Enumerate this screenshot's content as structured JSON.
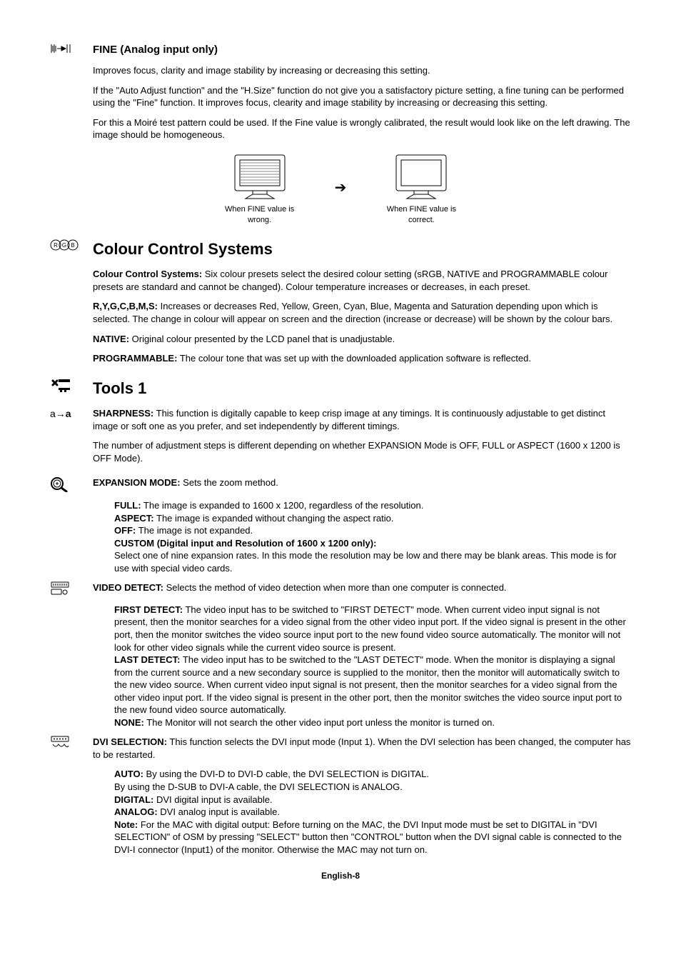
{
  "fine": {
    "icon": "fine-icon",
    "title": "FINE (Analog input only)",
    "p1": "Improves focus, clarity and image stability by increasing or decreasing this setting.",
    "p2": "If the \"Auto Adjust function\" and the \"H.Size\" function do not give you a satisfactory picture setting, a fine tuning can be performed using the \"Fine\" function. It improves focus, clearity and image stability by increasing or decreasing this setting.",
    "p3": "For this a Moiré test pattern could be used. If the Fine value is wrongly calibrated, the result would look like on the left drawing. The image should be homogeneous.",
    "fig_wrong": "When FINE value is wrong.",
    "fig_correct": "When FINE value is correct."
  },
  "colour": {
    "icon": "rgb-icon",
    "title": "Colour Control Systems",
    "ccs_label": "Colour Control Systems:",
    "ccs_body": " Six colour presets select the desired colour setting (sRGB, NATIVE and PROGRAMMABLE colour presets are standard and cannot be changed). Colour temperature increases or decreases, in each preset.",
    "rgb_label": "R,Y,G,C,B,M,S:",
    "rgb_body": " Increases or decreases Red, Yellow, Green, Cyan, Blue, Magenta and Saturation depending upon which is selected. The change in colour will appear on screen and the direction (increase or decrease) will be shown by the colour bars.",
    "native_label": "NATIVE:",
    "native_body": " Original colour presented by the LCD panel that is unadjustable.",
    "prog_label": "PROGRAMMABLE:",
    "prog_body": " The colour tone that was set up with the downloaded application software is reflected."
  },
  "tools": {
    "icon": "tools-icon",
    "title": "Tools 1",
    "sharp_icon": "sharpness-icon",
    "sharp_label": "SHARPNESS:",
    "sharp_body": " This function is digitally capable to keep crisp image at any timings. It is continuously adjustable to get distinct image or soft one as you prefer, and set independently by different timings.",
    "sharp_p2": "The number of adjustment steps is different depending on whether EXPANSION Mode is OFF, FULL or ASPECT (1600 x 1200 is OFF Mode).",
    "exp_icon": "expansion-icon",
    "exp_label": "EXPANSION MODE:",
    "exp_body": " Sets the zoom method.",
    "exp_full_label": "FULL:",
    "exp_full_body": " The image is expanded to 1600 x 1200, regardless of the resolution.",
    "exp_aspect_label": "ASPECT:",
    "exp_aspect_body": " The image is expanded without changing the aspect ratio.",
    "exp_off_label": "OFF:",
    "exp_off_body": " The image is not expanded.",
    "exp_custom_label": "CUSTOM (Digital input and Resolution of 1600 x 1200 only):",
    "exp_custom_body": "Select one of nine expansion rates. In this mode the resolution may be low and there may be blank areas. This mode is for use with special video cards.",
    "vd_icon": "video-detect-icon",
    "vd_label": "VIDEO DETECT:",
    "vd_body": " Selects the method of video detection when more than one computer is connected.",
    "vd_first_label": "FIRST DETECT:",
    "vd_first_body": " The video input has to be switched to \"FIRST DETECT\" mode. When current video input signal is not present, then the monitor searches for a video signal from the other video input port. If the video signal is present in the other port, then the monitor switches the video source input port to the new found video source automatically. The monitor will not look for other video signals while the current video source is present.",
    "vd_last_label": "LAST DETECT:",
    "vd_last_body": " The video input has to be switched to the \"LAST DETECT\" mode. When the monitor is displaying a signal from the current source and a new secondary source is supplied to the monitor, then the monitor will automatically switch to the new video source. When current video input signal is not present, then the monitor searches for a video signal from the other video input port. If the video signal is present in the other port, then the monitor switches the video source input port to the new found video source automatically.",
    "vd_none_label": "NONE:",
    "vd_none_body": " The Monitor will not search the other video input port unless the monitor is turned on.",
    "dvi_icon": "dvi-icon",
    "dvi_label": "DVI SELECTION:",
    "dvi_body": " This function selects the DVI input mode (Input 1). When the DVI selection has been changed, the computer has to be restarted.",
    "dvi_auto_label": "AUTO:",
    "dvi_auto_body": " By using the DVI-D to DVI-D cable, the DVI SELECTION is DIGITAL.",
    "dvi_auto_body2": "By using the D-SUB to DVI-A cable, the DVI SELECTION is ANALOG.",
    "dvi_digital_label": "DIGITAL:",
    "dvi_digital_body": " DVI digital input is available.",
    "dvi_analog_label": "ANALOG:",
    "dvi_analog_body": " DVI analog input is available.",
    "dvi_note_label": "Note:",
    "dvi_note_body": " For the MAC with digital output: Before turning on the MAC, the DVI Input mode must be set to DIGITAL in \"DVI SELECTION\" of OSM by pressing \"SELECT\" button then \"CONTROL\" button when the DVI signal cable is connected to the DVI-I connector (Input1) of the monitor. Otherwise the MAC may not turn on."
  },
  "footer": "English-8"
}
